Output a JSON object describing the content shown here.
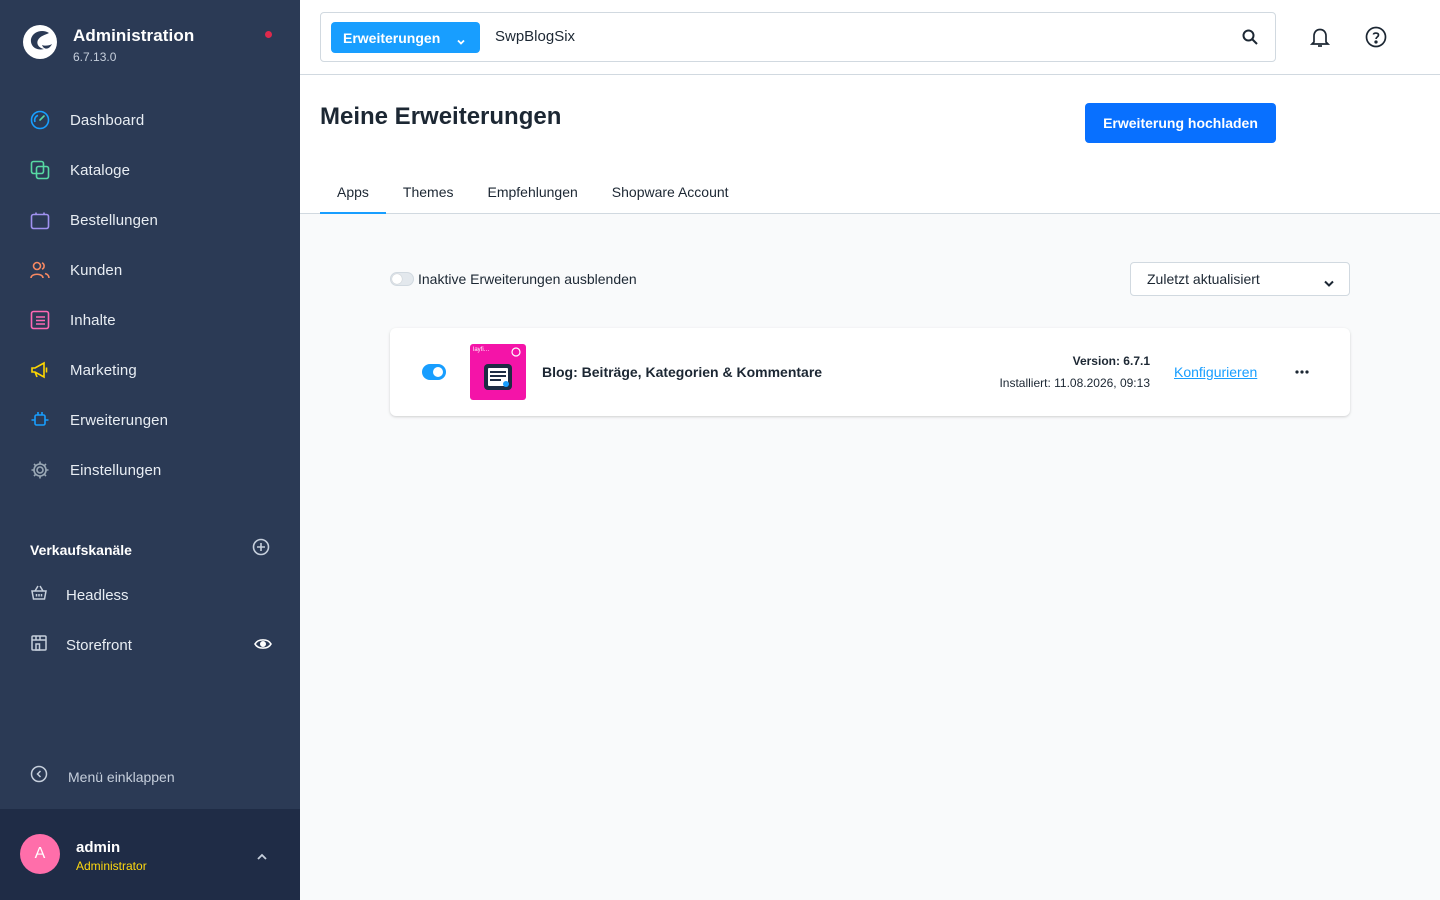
{
  "app": {
    "title": "Administration",
    "version": "6.7.13.0"
  },
  "sidebar": {
    "items": [
      {
        "label": "Dashboard",
        "icon": "dashboard-icon",
        "color": "#57d9a3"
      },
      {
        "label": "Kataloge",
        "icon": "catalog-icon",
        "color": "#57d9a3"
      },
      {
        "label": "Bestellungen",
        "icon": "orders-icon",
        "color": "#a092f0"
      },
      {
        "label": "Kunden",
        "icon": "customers-icon",
        "color": "#f88962"
      },
      {
        "label": "Inhalte",
        "icon": "content-icon",
        "color": "#ff68b4"
      },
      {
        "label": "Marketing",
        "icon": "marketing-icon",
        "color": "#ffd700"
      },
      {
        "label": "Erweiterungen",
        "icon": "extensions-icon",
        "color": "#189eff"
      },
      {
        "label": "Einstellungen",
        "icon": "settings-icon",
        "color": "#9aa8b5"
      }
    ],
    "sales_channels": {
      "title": "Verkaufskanäle",
      "items": [
        {
          "label": "Headless",
          "icon": "basket-icon"
        },
        {
          "label": "Storefront",
          "icon": "storefront-icon"
        }
      ]
    },
    "collapse_label": "Menü einklappen",
    "user": {
      "initial": "A",
      "name": "admin",
      "role": "Administrator"
    }
  },
  "search": {
    "type_label": "Erweiterungen",
    "value": "SwpBlogSix"
  },
  "page": {
    "title": "Meine Erweiterungen",
    "upload_label": "Erweiterung hochladen",
    "tabs": [
      "Apps",
      "Themes",
      "Empfehlungen",
      "Shopware Account"
    ],
    "active_tab": "Apps"
  },
  "filter": {
    "hide_inactive_label": "Inaktive Erweiterungen ausblenden",
    "hide_inactive_on": false,
    "sort_value": "Zuletzt aktualisiert"
  },
  "extension": {
    "active": true,
    "icon_text": "layfi…",
    "name": "Blog: Beiträge, Kategorien & Kommentare",
    "version": "Version: 6.7.1",
    "installed": "Installiert: 11.08.2026, 09:13",
    "configure_label": "Konfigurieren"
  },
  "colors": {
    "sidebar_bg": "#2b3a55",
    "primary": "#189eff",
    "button_primary": "#0870ff",
    "extension_icon_bg": "#f414a8",
    "avatar": "#ff6eaa",
    "notification_dot": "#de294c"
  }
}
